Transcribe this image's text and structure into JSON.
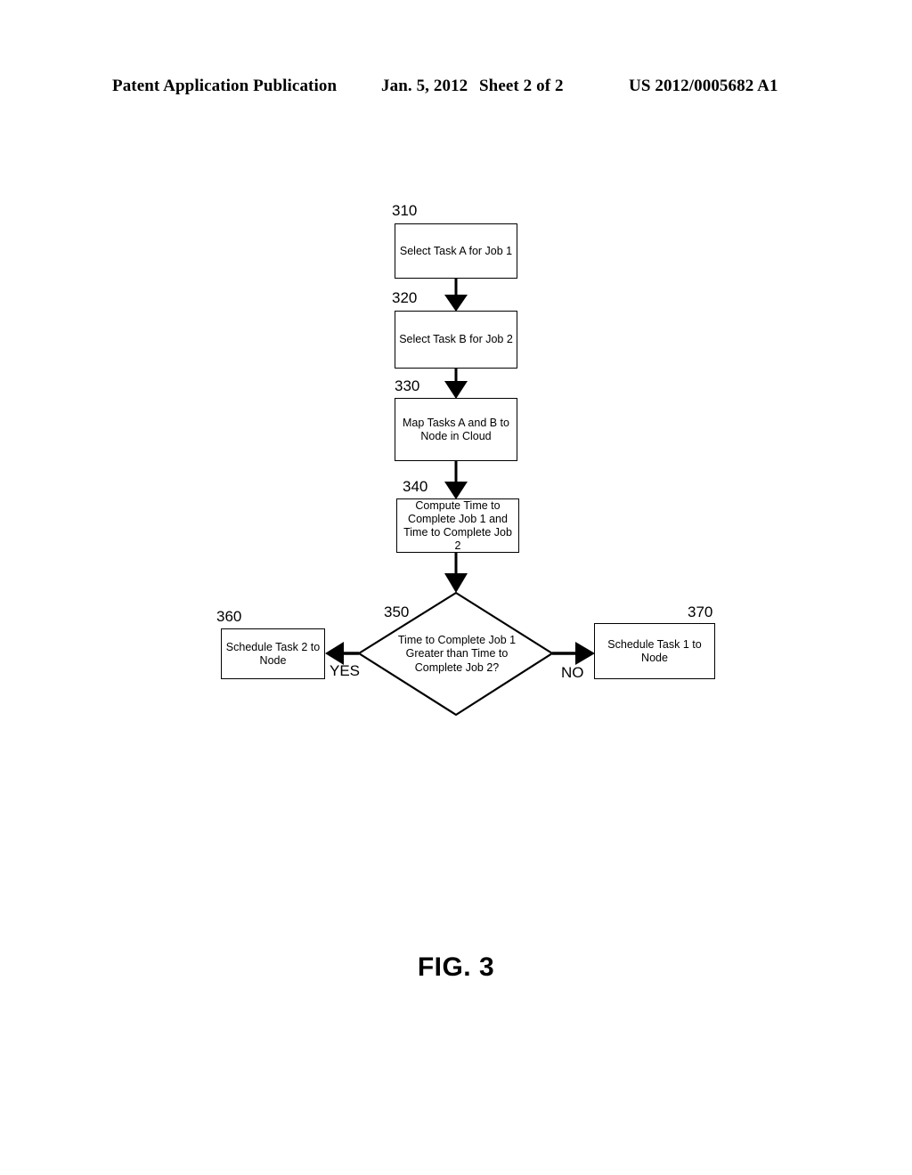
{
  "header": {
    "publication": "Patent Application Publication",
    "date": "Jan. 5, 2012",
    "sheet": "Sheet 2 of 2",
    "patent_number": "US 2012/0005682 A1"
  },
  "figure": {
    "caption": "FIG. 3",
    "nodes": {
      "n310": {
        "ref": "310",
        "text": "Select Task A for Job 1",
        "shape": "process"
      },
      "n320": {
        "ref": "320",
        "text": "Select Task B for Job 2",
        "shape": "process"
      },
      "n330": {
        "ref": "330",
        "text": "Map Tasks A and B to Node in Cloud",
        "shape": "process"
      },
      "n340": {
        "ref": "340",
        "text": "Compute Time to Complete Job 1 and Time to Complete Job 2",
        "shape": "process"
      },
      "n350": {
        "ref": "350",
        "text": "Time to Complete Job 1 Greater than Time to Complete Job 2?",
        "shape": "decision"
      },
      "n360": {
        "ref": "360",
        "text": "Schedule Task 2 to Node",
        "shape": "process"
      },
      "n370": {
        "ref": "370",
        "text": "Schedule Task 1 to Node",
        "shape": "process"
      }
    },
    "branches": {
      "yes": "YES",
      "no": "NO"
    },
    "colors": {
      "stroke": "#000000",
      "fill": "#ffffff"
    }
  }
}
